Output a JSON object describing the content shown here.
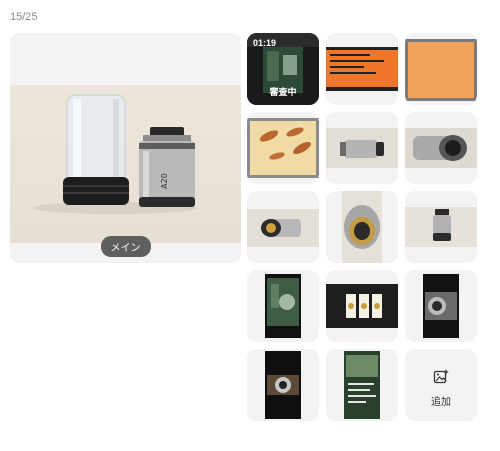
{
  "counter": "15/25",
  "main": {
    "badge": "メイン"
  },
  "thumbs": {
    "video_duration": "01:19",
    "review_status": "審査中",
    "slide_text": [
      "Hier USA Based...",
      "Grey 3D microscope camera...",
      "...w/ cover the half",
      "...Kong build with SMF"
    ]
  },
  "add": {
    "label": "追加",
    "icon": "add-image-icon"
  },
  "colors": {
    "badge_bg": "#5f5f5f",
    "tile_bg": "#f3f3f3",
    "slide_orange": "#f0772a"
  }
}
